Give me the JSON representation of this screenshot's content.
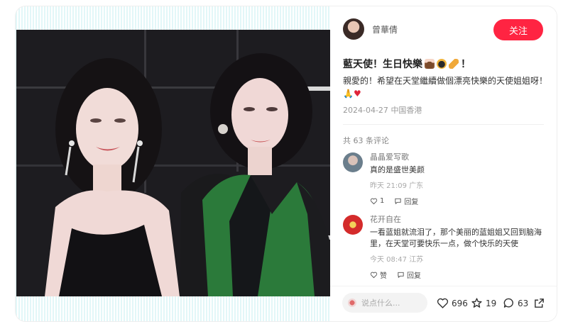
{
  "author": {
    "name": "曾華倩",
    "follow_label": "关注"
  },
  "post": {
    "title": "藍天使！生日快樂",
    "title_end": "！",
    "title_emojis": [
      "cake-icon",
      "crown-icon",
      "party-popper-icon"
    ],
    "description": "親愛的！希望在天堂繼續做個漂亮快樂的天使姐姐呀！",
    "description_emojis": [
      "praying-hands-icon",
      "heart-icon"
    ],
    "date": "2024-04-27",
    "location": "中国香港"
  },
  "comments_count_label": "共 63 条评论",
  "comments": [
    {
      "user": "晶晶爱写歌",
      "text": "真的是盛世美颜",
      "time": "昨天 21:09",
      "location": "广东",
      "likes": "1",
      "reply_label": "回复"
    },
    {
      "user": "花开自在",
      "text": "一看蓝姐就流泪了，那个美丽的蓝姐姐又回到脑海里，在天堂可要快乐一点，做个快乐的天使",
      "time": "今天 08:47",
      "location": "江苏",
      "likes": "赞",
      "reply_label": "回复"
    }
  ],
  "bottom_bar": {
    "input_placeholder": "说点什么...",
    "likes": "696",
    "collects": "19",
    "comments": "63"
  },
  "colors": {
    "accent": "#ff2442",
    "media_stripe": "#e2f7f8"
  }
}
